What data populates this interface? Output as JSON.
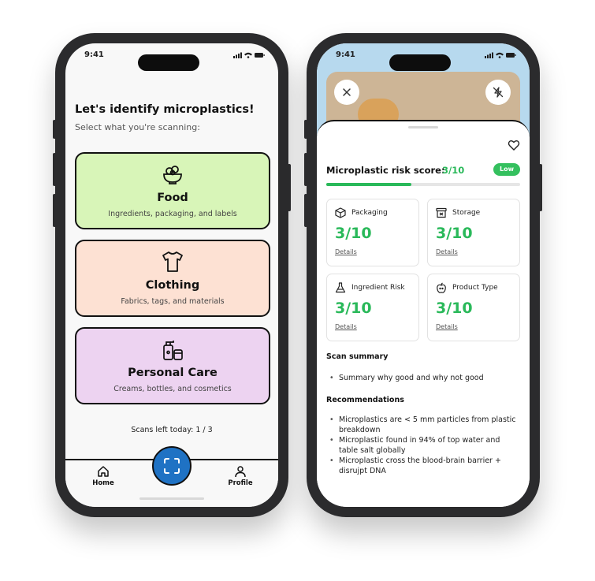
{
  "left": {
    "time": "9:41",
    "title": "Let's identify microplastics!",
    "subtitle": "Select what you're scanning:",
    "cards": [
      {
        "title": "Food",
        "description": "Ingredients, packaging, and labels",
        "icon": "food-bowl-icon",
        "color": "#d8f5b8"
      },
      {
        "title": "Clothing",
        "description": "Fabrics, tags, and materials",
        "icon": "tshirt-icon",
        "color": "#fde1d3"
      },
      {
        "title": "Personal Care",
        "description": "Creams, bottles, and cosmetics",
        "icon": "cosmetics-icon",
        "color": "#edd3f1"
      }
    ],
    "scans_left": "Scans left today: 1 / 3",
    "tabs": [
      {
        "label": "Home",
        "icon": "home-icon"
      },
      {
        "label": "Profile",
        "icon": "profile-icon"
      }
    ],
    "scan_button_icon": "scan-frame-icon",
    "accent": "#1f72c4"
  },
  "right": {
    "time": "9:41",
    "risk_label": "Microplastic risk score:",
    "risk_score": "3/10",
    "risk_level": "Low",
    "risk_progress": 0.44,
    "metrics": [
      {
        "label": "Packaging",
        "value": "3/10",
        "details": "Details",
        "icon": "box-icon"
      },
      {
        "label": "Storage",
        "value": "3/10",
        "details": "Details",
        "icon": "storage-bin-icon"
      },
      {
        "label": "Ingredient Risk",
        "value": "3/10",
        "details": "Details",
        "icon": "flask-icon"
      },
      {
        "label": "Product Type",
        "value": "3/10",
        "details": "Details",
        "icon": "apple-icon"
      }
    ],
    "summary_title": "Scan summary",
    "summary_items": [
      "Summary why good and why not good"
    ],
    "recommendations_title": "Recommendations",
    "recommendations": [
      "Microplastics are < 5 mm particles from plastic breakdown",
      "Microplastic found in 94% of top water and table salt globally",
      "Microplastic cross the blood-brain barrier + disrujpt DNA"
    ],
    "score_color": "#2ab95a"
  }
}
